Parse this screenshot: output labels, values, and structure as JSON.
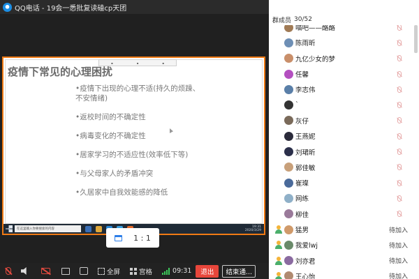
{
  "window": {
    "title": "QQ电话 - 19会一悉批复读磕cp天团"
  },
  "slide": {
    "title": "疫情下常见的心理困扰",
    "bullets": [
      "•疫情下出现的心理不适(持久的烦躁、",
      "  不安情绪)",
      "•返校时间的不确定性",
      "•病毒变化的不确定性",
      "•居家学习的不适应性(效率低下等)",
      "•与父母家人的矛盾冲突",
      "•久居家中自我效能感的降低"
    ],
    "taskbar_search": "在这里输入你要搜索的内容",
    "taskbar_time": "19:31",
    "taskbar_date": "2020/3/29"
  },
  "ratio_button": {
    "label": "1 : 1"
  },
  "toolbar": {
    "fullscreen": "全屏",
    "grid": "宫格",
    "time": "09:31",
    "exit": "退出",
    "end": "结束通..."
  },
  "panel": {
    "header": "群成员",
    "count": "30/52",
    "members": [
      {
        "name": "喵吧——酪酪",
        "avatar": "#a07a55",
        "status": "muted"
      },
      {
        "name": "陈雨昕",
        "avatar": "#6e8fb5",
        "status": "muted"
      },
      {
        "name": "九亿少女的梦",
        "avatar": "#c98f6a",
        "status": "muted"
      },
      {
        "name": "任馨",
        "avatar": "#b44fc0",
        "status": "muted"
      },
      {
        "name": "李志伟",
        "avatar": "#5a7fa8",
        "status": "muted"
      },
      {
        "name": "`",
        "avatar": "#333333",
        "status": "muted"
      },
      {
        "name": "灰仔",
        "avatar": "#7a6a5a",
        "status": "muted"
      },
      {
        "name": "王燕妮",
        "avatar": "#2a2a3a",
        "status": "muted"
      },
      {
        "name": "刘珺昕",
        "avatar": "#2b2f4a",
        "status": "muted"
      },
      {
        "name": "郭佳敏",
        "avatar": "#c8a07a",
        "status": "muted"
      },
      {
        "name": "崔璨",
        "avatar": "#4a6a9a",
        "status": "muted"
      },
      {
        "name": "网练",
        "avatar": "#8fb0c8",
        "status": "muted"
      },
      {
        "name": "柳佳",
        "avatar": "#9a7a9a",
        "status": "muted"
      },
      {
        "name": "猛男",
        "avatar": "#d09a6a",
        "status": "pending",
        "status_text": "待加入"
      },
      {
        "name": "我爱lwj",
        "avatar": "#6a8a6a",
        "status": "pending",
        "status_text": "待加入"
      },
      {
        "name": "刘亦君",
        "avatar": "#8a6aa0",
        "status": "pending",
        "status_text": "待加入"
      },
      {
        "name": "王心怡",
        "avatar": "#b08a70",
        "status": "pending",
        "status_text": "待加入"
      }
    ]
  }
}
